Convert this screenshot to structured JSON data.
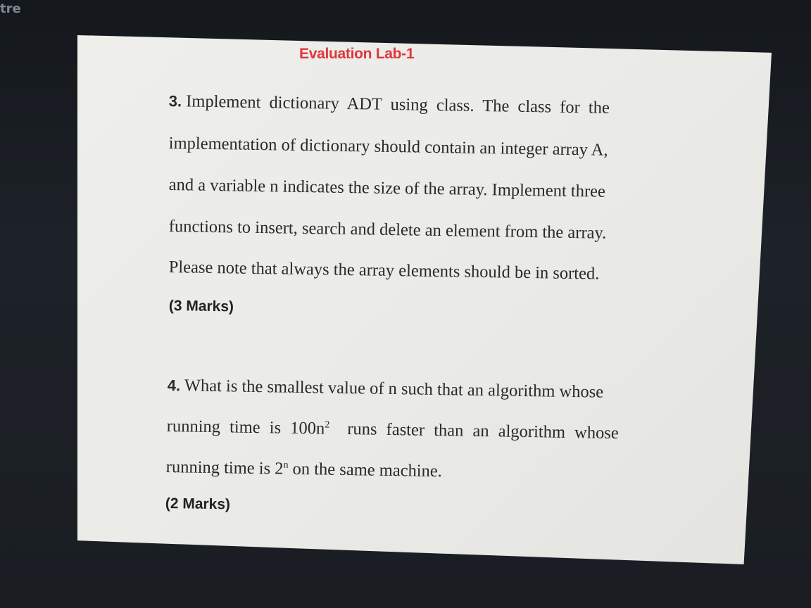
{
  "corner_label": "tre",
  "slide": {
    "title": "Evaluation Lab-1",
    "q3": {
      "number": "3.",
      "line1_rest": "Implement dictionary ADT using class. The class for the",
      "line2": "implementation of dictionary should contain an integer array A,",
      "line3": "and a variable n indicates the size of the array. Implement three",
      "line4": "functions to insert, search and delete an element from the array.",
      "line5": "Please note that always the array elements should be in sorted.",
      "marks": "(3 Marks)"
    },
    "q4": {
      "number": "4.",
      "line1_rest": "What is the smallest value of n such that an algorithm whose",
      "line2_a": "running time is 100n",
      "line2_sup": "2",
      "line2_b": "runs faster than an algorithm whose",
      "line3_a": "running time is 2",
      "line3_sup": "n",
      "line3_b": "on the same machine.",
      "marks": "(2 Marks)"
    }
  }
}
